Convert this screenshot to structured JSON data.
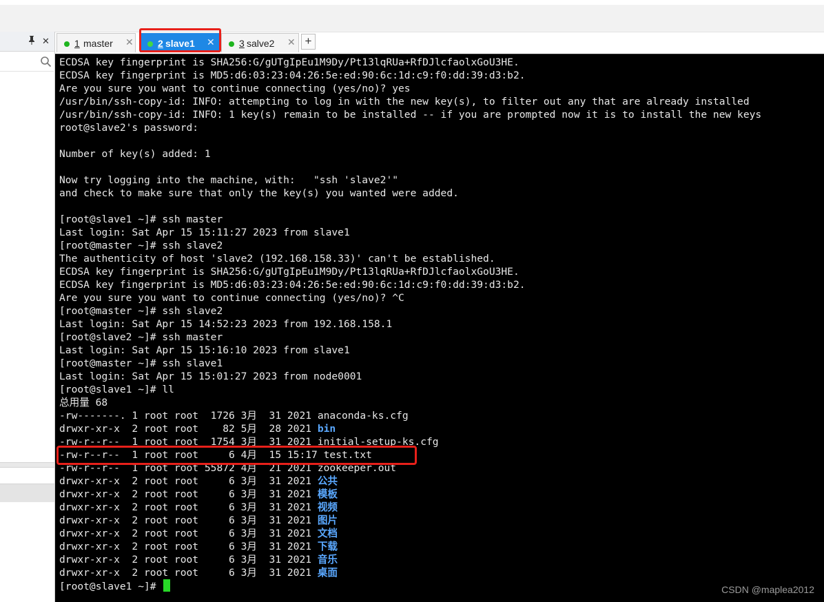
{
  "side": {
    "pin_icon": "pin-icon",
    "close_label": "✕",
    "search_icon": "search-icon"
  },
  "tabs": [
    {
      "num": "1",
      "label": "master",
      "close": "✕"
    },
    {
      "num": "2",
      "label": "slave1",
      "close": "✕"
    },
    {
      "num": "3",
      "label": "salve2",
      "close": "✕"
    }
  ],
  "tab_add": "+",
  "terminal": {
    "lines": [
      "ECDSA key fingerprint is SHA256:G/gUTgIpEu1M9Dy/Pt13lqRUa+RfDJlcfaolxGoU3HE.",
      "ECDSA key fingerprint is MD5:d6:03:23:04:26:5e:ed:90:6c:1d:c9:f0:dd:39:d3:b2.",
      "Are you sure you want to continue connecting (yes/no)? yes",
      "/usr/bin/ssh-copy-id: INFO: attempting to log in with the new key(s), to filter out any that are already installed",
      "/usr/bin/ssh-copy-id: INFO: 1 key(s) remain to be installed -- if you are prompted now it is to install the new keys",
      "root@slave2's password:",
      "",
      "Number of key(s) added: 1",
      "",
      "Now try logging into the machine, with:   \"ssh 'slave2'\"",
      "and check to make sure that only the key(s) you wanted were added.",
      "",
      "[root@slave1 ~]# ssh master",
      "Last login: Sat Apr 15 15:11:27 2023 from slave1",
      "[root@master ~]# ssh slave2",
      "The authenticity of host 'slave2 (192.168.158.33)' can't be established.",
      "ECDSA key fingerprint is SHA256:G/gUTgIpEu1M9Dy/Pt13lqRUa+RfDJlcfaolxGoU3HE.",
      "ECDSA key fingerprint is MD5:d6:03:23:04:26:5e:ed:90:6c:1d:c9:f0:dd:39:d3:b2.",
      "Are you sure you want to continue connecting (yes/no)? ^C",
      "[root@master ~]# ssh slave2",
      "Last login: Sat Apr 15 14:52:23 2023 from 192.168.158.1",
      "[root@slave2 ~]# ssh master",
      "Last login: Sat Apr 15 15:16:10 2023 from slave1",
      "[root@master ~]# ssh slave1",
      "Last login: Sat Apr 15 15:01:27 2023 from node0001",
      "[root@slave1 ~]# ll",
      "总用量 68"
    ],
    "listing": [
      {
        "meta": "-rw-------. 1 root root  1726 3月  31 2021 ",
        "name": "anaconda-ks.cfg",
        "dir": false
      },
      {
        "meta": "drwxr-xr-x  2 root root    82 5月  28 2021 ",
        "name": "bin",
        "dir": true
      },
      {
        "meta": "-rw-r--r--  1 root root  1754 3月  31 2021 ",
        "name": "initial-setup-ks.cfg",
        "dir": false
      },
      {
        "meta": "-rw-r--r--  1 root root     6 4月  15 15:17 ",
        "name": "test.txt",
        "dir": false
      },
      {
        "meta": "-rw-r--r--  1 root root 55872 4月  21 2021 ",
        "name": "zookeeper.out",
        "dir": false
      },
      {
        "meta": "drwxr-xr-x  2 root root     6 3月  31 2021 ",
        "name": "公共",
        "dir": true
      },
      {
        "meta": "drwxr-xr-x  2 root root     6 3月  31 2021 ",
        "name": "模板",
        "dir": true
      },
      {
        "meta": "drwxr-xr-x  2 root root     6 3月  31 2021 ",
        "name": "视频",
        "dir": true
      },
      {
        "meta": "drwxr-xr-x  2 root root     6 3月  31 2021 ",
        "name": "图片",
        "dir": true
      },
      {
        "meta": "drwxr-xr-x  2 root root     6 3月  31 2021 ",
        "name": "文档",
        "dir": true
      },
      {
        "meta": "drwxr-xr-x  2 root root     6 3月  31 2021 ",
        "name": "下载",
        "dir": true
      },
      {
        "meta": "drwxr-xr-x  2 root root     6 3月  31 2021 ",
        "name": "音乐",
        "dir": true
      },
      {
        "meta": "drwxr-xr-x  2 root root     6 3月  31 2021 ",
        "name": "桌面",
        "dir": true
      }
    ],
    "prompt": "[root@slave1 ~]# "
  },
  "watermark": "CSDN @maplea2012",
  "colors": {
    "terminal_bg": "#000000",
    "terminal_fg": "#e8e8e8",
    "dir_blue": "#5aa8ff",
    "cursor_green": "#27d827",
    "active_tab": "#1e88e5",
    "highlight_red": "#e8201a",
    "status_dot_green": "#1fb51f"
  }
}
